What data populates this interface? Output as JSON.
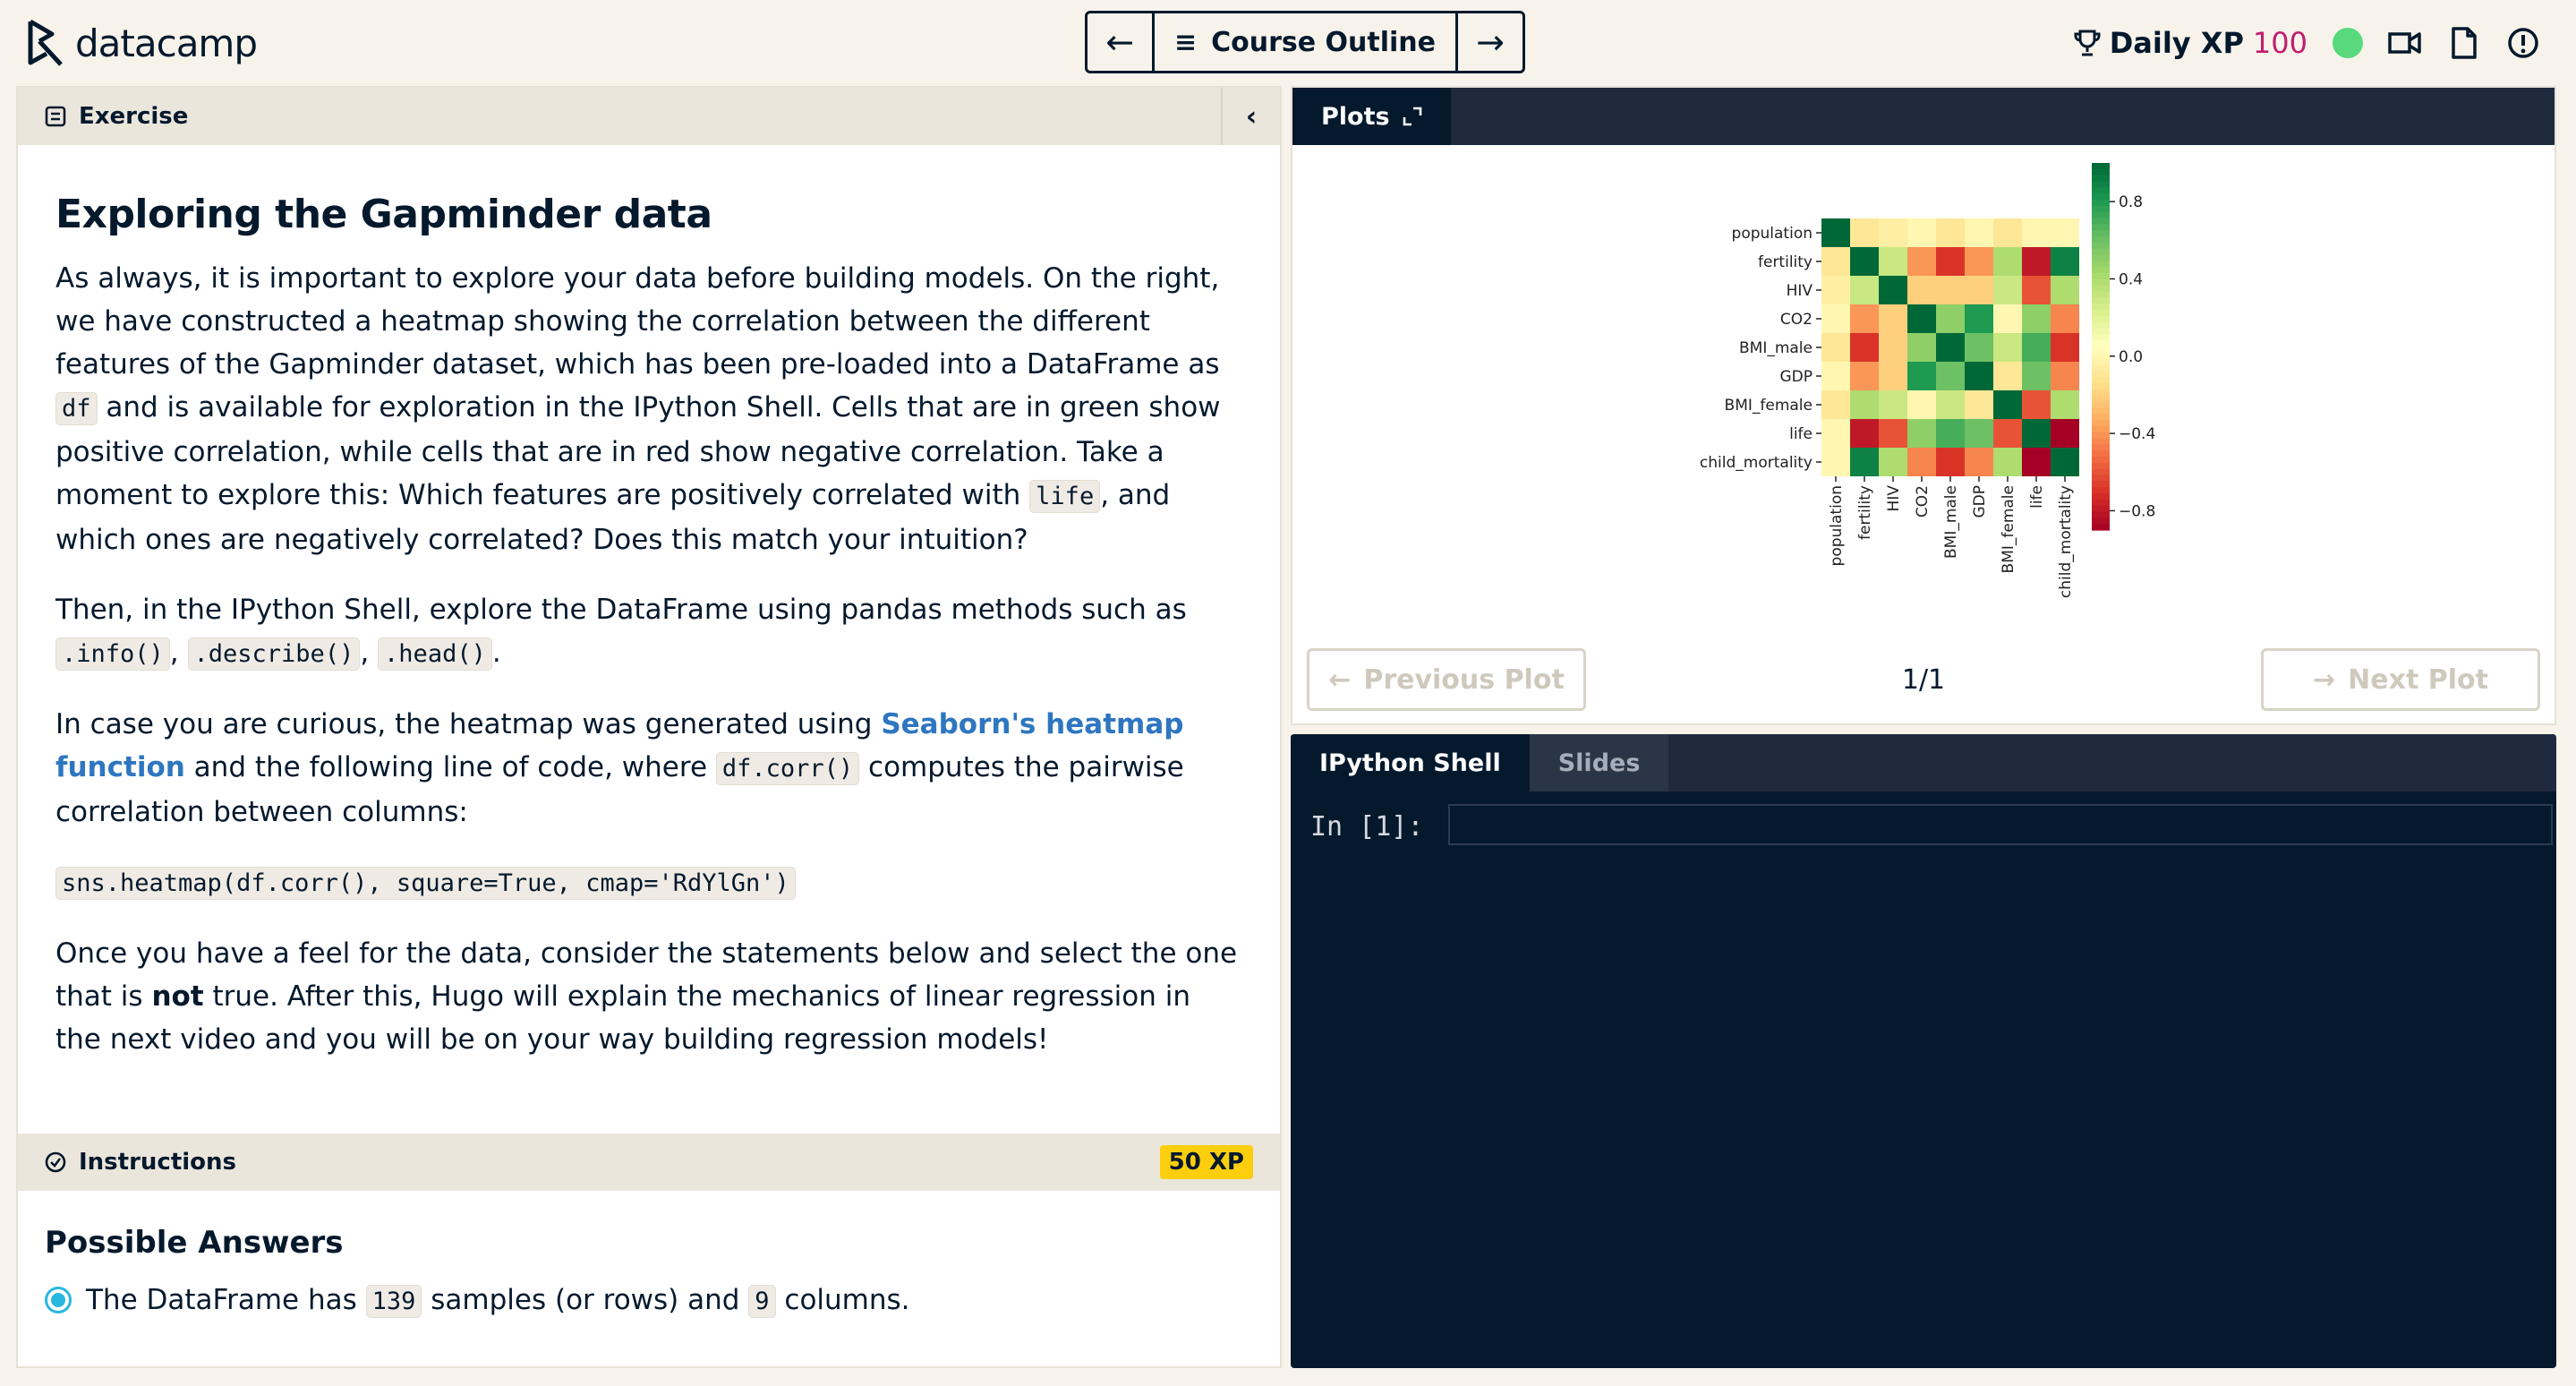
{
  "header": {
    "logo_text": "datacamp",
    "nav": {
      "prev_arrow": "←",
      "next_arrow": "→",
      "outline_label": "Course Outline",
      "outline_icon": "≡"
    },
    "daily_xp_label": "Daily XP",
    "daily_xp_value": "100"
  },
  "exercise": {
    "tab_label": "Exercise",
    "collapse_icon": "‹",
    "title": "Exploring the Gapminder data",
    "p1": {
      "a": "As always, it is important to explore your data before building models. On the right, we have constructed a heatmap showing the correlation between the different features of the Gapminder dataset, which has been pre-loaded into a DataFrame as ",
      "code1": "df",
      "b": " and is available for exploration in the IPython Shell. Cells that are in green show positive correlation, while cells that are in red show negative correlation. Take a moment to explore this: Which features are positively correlated with ",
      "code2": "life",
      "c": ", and which ones are negatively correlated? Does this match your intuition?"
    },
    "p2": {
      "a": "Then, in the IPython Shell, explore the DataFrame using pandas methods such as ",
      "code1": ".info()",
      "sep1": ", ",
      "code2": ".describe()",
      "sep2": ", ",
      "code3": ".head()",
      "end": "."
    },
    "p3": {
      "a": "In case you are curious, the heatmap was generated using ",
      "link": "Seaborn's heatmap function",
      "b": " and the following line of code, where ",
      "code1": "df.corr()",
      "c": " computes the pairwise correlation between columns:"
    },
    "code_line": "sns.heatmap(df.corr(), square=True, cmap='RdYlGn')",
    "p4": {
      "a": "Once you have a feel for the data, consider the statements below and select the one that is ",
      "bold": "not",
      "b": " true. After this, Hugo will explain the mechanics of linear regression in the next video and you will be on your way building regression models!"
    }
  },
  "instructions": {
    "label": "Instructions",
    "xp_badge": "50 XP",
    "answers_title": "Possible Answers",
    "answer1": {
      "a": "The DataFrame has ",
      "code1": "139",
      "b": " samples (or rows) and ",
      "code2": "9",
      "c": " columns."
    }
  },
  "plots": {
    "tab_label": "Plots",
    "prev_label": "Previous Plot",
    "next_label": "Next Plot",
    "count": "1/1"
  },
  "shell": {
    "tab_shell": "IPython Shell",
    "tab_slides": "Slides",
    "prompt": "In [1]:"
  },
  "chart_data": {
    "type": "heatmap",
    "labels": [
      "population",
      "fertility",
      "HIV",
      "CO2",
      "BMI_male",
      "GDP",
      "BMI_female",
      "life",
      "child_mortality"
    ],
    "values": [
      [
        1.0,
        -0.1,
        -0.05,
        0.0,
        -0.1,
        0.0,
        -0.1,
        0.0,
        0.0
      ],
      [
        -0.1,
        1.0,
        0.3,
        -0.4,
        -0.7,
        -0.4,
        0.4,
        -0.8,
        0.9
      ],
      [
        -0.05,
        0.3,
        1.0,
        -0.2,
        -0.2,
        -0.2,
        0.3,
        -0.6,
        0.4
      ],
      [
        0.0,
        -0.4,
        -0.2,
        1.0,
        0.5,
        0.8,
        0.0,
        0.5,
        -0.45
      ],
      [
        -0.1,
        -0.7,
        -0.2,
        0.5,
        1.0,
        0.6,
        0.3,
        0.7,
        -0.7
      ],
      [
        0.0,
        -0.4,
        -0.2,
        0.8,
        0.6,
        1.0,
        -0.1,
        0.6,
        -0.45
      ],
      [
        -0.1,
        0.4,
        0.3,
        0.0,
        0.3,
        -0.1,
        1.0,
        -0.6,
        0.4
      ],
      [
        0.0,
        -0.8,
        -0.6,
        0.5,
        0.7,
        0.6,
        -0.6,
        1.0,
        -0.9
      ],
      [
        0.0,
        0.9,
        0.4,
        -0.45,
        -0.7,
        -0.45,
        0.4,
        -0.9,
        1.0
      ]
    ],
    "colorbar_ticks": [
      "0.8",
      "0.4",
      "0.0",
      "−0.4",
      "−0.8"
    ],
    "colorbar_tick_values": [
      0.8,
      0.4,
      0.0,
      -0.4,
      -0.8
    ],
    "vmin": -0.9,
    "vmax": 1.0,
    "cmap": "RdYlGn"
  }
}
